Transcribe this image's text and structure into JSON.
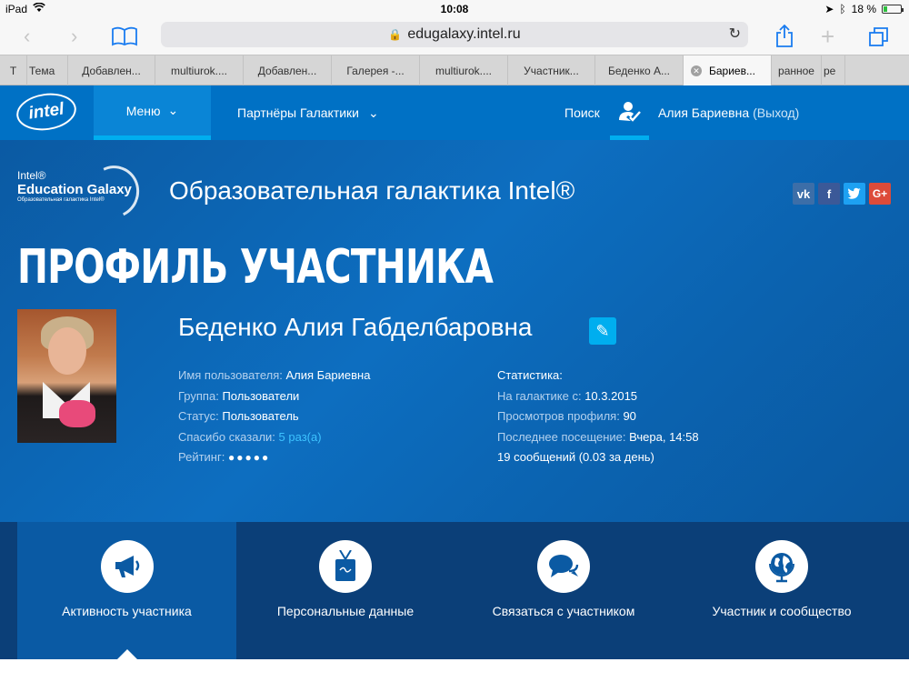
{
  "status_bar": {
    "device": "iPad",
    "time": "10:08",
    "battery": "18 %",
    "battery_level": 0.18
  },
  "browser": {
    "url": "edugalaxy.intel.ru",
    "tabs": [
      {
        "label": "Т"
      },
      {
        "label": "Тема"
      },
      {
        "label": "Добавлен..."
      },
      {
        "label": "multiurok...."
      },
      {
        "label": "Добавлен..."
      },
      {
        "label": "Галерея -..."
      },
      {
        "label": "multiurok...."
      },
      {
        "label": "Участник..."
      },
      {
        "label": "Беденко А..."
      },
      {
        "label": "Бариев..."
      },
      {
        "label": "ранное"
      },
      {
        "label": "ре"
      }
    ]
  },
  "nav": {
    "logo": "intel",
    "menu": "Меню",
    "partners": "Партнёры Галактики",
    "search": "Поиск",
    "user_name": "Алия Бариевна",
    "logout": "(Выход)"
  },
  "header": {
    "brand_line1": "Intel®",
    "brand_line2": "Education Galaxy",
    "brand_line3": "Образовательная галактика Intel®",
    "site_title": "Образовательная галактика Intel®",
    "socials": [
      "vk",
      "f",
      "twitter",
      "G+"
    ],
    "page_heading": "ПРОФИЛЬ УЧАСТНИКА"
  },
  "profile": {
    "full_name": "Беденко Алия Габделбаровна",
    "username_label": "Имя пользователя:",
    "username": "Алия Бариевна",
    "group_label": "Группа:",
    "group": "Пользователи",
    "status_label": "Статус:",
    "status": "Пользователь",
    "thanks_label": "Спасибо сказали:",
    "thanks": "5 раз(а)",
    "rating_label": "Рейтинг:",
    "rating_dots": "●●●●●",
    "rating_value": 5
  },
  "stats": {
    "title": "Статистика:",
    "since_label": "На галактике с:",
    "since": "10.3.2015",
    "views_label": "Просмотров профиля:",
    "views": "90",
    "last_visit_label": "Последнее посещение:",
    "last_visit": "Вчера, 14:58",
    "messages": "19 сообщений (0.03 за день)"
  },
  "bottom_tabs": [
    {
      "label": "Активность участника",
      "icon": "megaphone-icon"
    },
    {
      "label": "Персональные данные",
      "icon": "id-badge-icon"
    },
    {
      "label": "Связаться с участником",
      "icon": "chat-bubbles-icon"
    },
    {
      "label": "Участник и сообщество",
      "icon": "globe-icon"
    }
  ]
}
